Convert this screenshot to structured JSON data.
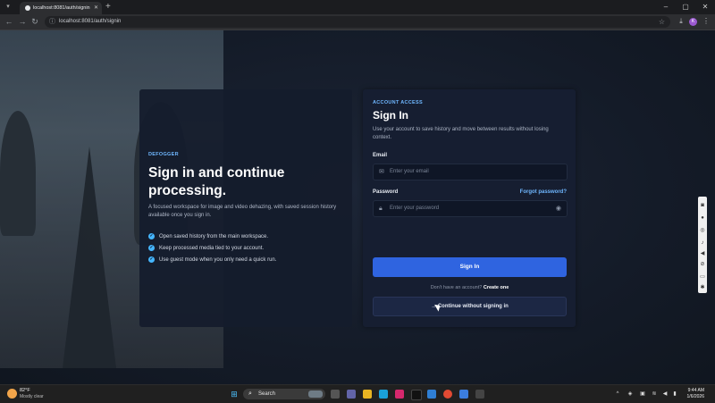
{
  "browser": {
    "tab_title": "localhost:8081/auth/signin",
    "url": "localhost:8081/auth/signin",
    "profile_initial": "K"
  },
  "hero": {
    "kicker": "DEFOGGER",
    "title": "Sign in and continue processing.",
    "subtitle": "A focused workspace for image and video dehazing, with saved session history available once you sign in.",
    "bullets": [
      "Open saved history from the main workspace.",
      "Keep processed media tied to your account.",
      "Use guest mode when you only need a quick run."
    ]
  },
  "signin": {
    "kicker": "ACCOUNT ACCESS",
    "title": "Sign In",
    "subtitle": "Use your account to save history and move between results without losing context.",
    "email_label": "Email",
    "email_placeholder": "Enter your email",
    "password_label": "Password",
    "forgot_label": "Forgot password?",
    "password_placeholder": "Enter your password",
    "submit_label": "Sign In",
    "no_account_text": "Don't have an account?",
    "create_label": "Create one",
    "guest_label": "Continue without signing in"
  },
  "taskbar": {
    "temperature": "82°F",
    "weather": "Mostly clear",
    "search_placeholder": "Search",
    "time": "9:44 AM",
    "date": "1/6/2026"
  },
  "colors": {
    "accent": "#2f64e0",
    "link": "#6fb7ff"
  }
}
